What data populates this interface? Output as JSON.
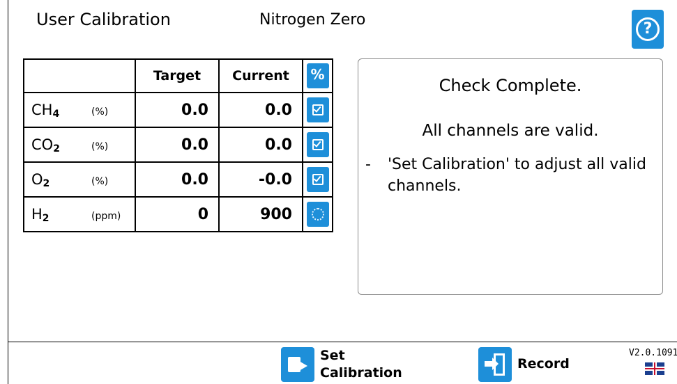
{
  "header": {
    "title": "User Calibration",
    "subtitle": "Nitrogen Zero",
    "help_label": "?"
  },
  "table": {
    "headers": {
      "gas": "",
      "target": "Target",
      "current": "Current",
      "select_all": "%"
    },
    "rows": [
      {
        "gas": "CH",
        "sub": "4",
        "unit": "(%)",
        "target": "0.0",
        "current": "0.0",
        "status": "checked"
      },
      {
        "gas": "CO",
        "sub": "2",
        "unit": "(%)",
        "target": "0.0",
        "current": "0.0",
        "status": "checked"
      },
      {
        "gas": "O",
        "sub": "2",
        "unit": "(%)",
        "target": "0.0",
        "current": "-0.0",
        "status": "checked"
      },
      {
        "gas": "H",
        "sub": "2",
        "unit": "(ppm)",
        "target": "0",
        "current": "900",
        "status": "busy"
      }
    ]
  },
  "message": {
    "title": "Check Complete.",
    "subtitle": "All channels are valid.",
    "bullet": "-",
    "body": "'Set Calibration' to adjust all valid channels."
  },
  "actions": {
    "set_calibration_line1": "Set",
    "set_calibration_line2": "Calibration",
    "record": "Record"
  },
  "footer": {
    "version": "V2.0.1091",
    "language_icon": "uk-flag-icon"
  },
  "colors": {
    "accent": "#1e8fd9",
    "border": "#000000",
    "panel_border": "#8a8a8a"
  }
}
